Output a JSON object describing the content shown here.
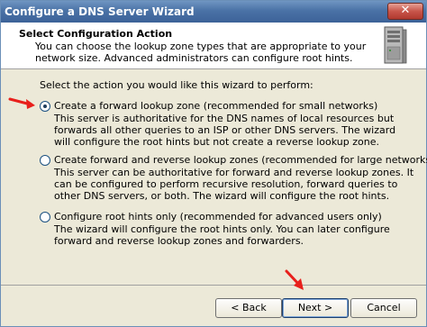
{
  "window": {
    "title": "Configure a DNS Server Wizard",
    "close_label": "✕"
  },
  "header": {
    "title": "Select Configuration Action",
    "description": "You can choose the lookup zone types that are appropriate to your network size. Advanced administrators can configure root hints."
  },
  "content": {
    "prompt": "Select the action you would like this wizard to perform:",
    "options": [
      {
        "label": "Create a forward lookup zone (recommended for small networks)",
        "description": "This server is authoritative for the DNS names of local resources but forwards all other queries to an ISP or other DNS servers. The wizard will configure the root hints but not create a reverse lookup zone.",
        "selected": true
      },
      {
        "label": "Create forward and reverse lookup zones (recommended for large networks)",
        "description": "This server can be authoritative for forward and reverse lookup zones. It can be configured to perform recursive resolution, forward queries to other DNS servers, or both. The wizard will configure the root hints.",
        "selected": false
      },
      {
        "label": "Configure root hints only (recommended for advanced users only)",
        "description": "The wizard will configure the root hints only. You can later configure forward and reverse lookup zones and forwarders.",
        "selected": false
      }
    ]
  },
  "footer": {
    "back_label": "< Back",
    "next_label": "Next >",
    "cancel_label": "Cancel"
  },
  "colors": {
    "annotation_arrow": "#e8201c",
    "title_bar": "#4a72a6"
  },
  "icons": {
    "header": "server-icon",
    "annotation": "red-arrow-icon"
  }
}
